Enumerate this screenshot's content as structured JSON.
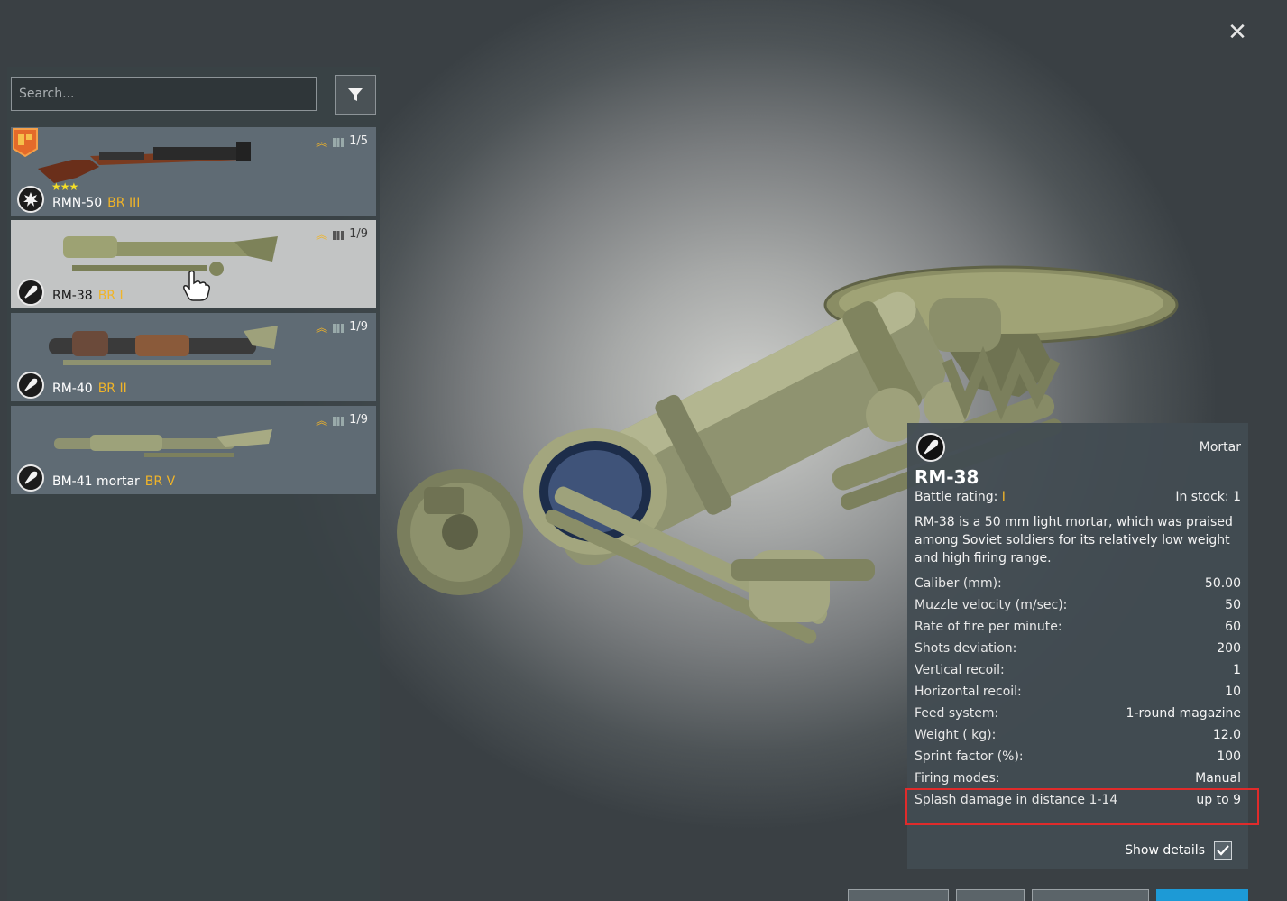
{
  "close_icon": "close-icon",
  "search": {
    "placeholder": "Search..."
  },
  "filter_icon": "filter-icon",
  "items": [
    {
      "name": "RMN-50",
      "br": "BR III",
      "stock": "1/5",
      "type_icon": "explosion-icon",
      "stars": "★★★",
      "battlepass_badge": "BP",
      "selected": false
    },
    {
      "name": "RM-38",
      "br": "BR I",
      "stock": "1/9",
      "type_icon": "mortar-shell-icon",
      "selected": true
    },
    {
      "name": "RM-40",
      "br": "BR II",
      "stock": "1/9",
      "type_icon": "mortar-shell-icon",
      "selected": false
    },
    {
      "name": "BM-41 mortar",
      "br": "BR V",
      "stock": "1/9",
      "type_icon": "mortar-shell-icon",
      "selected": false
    }
  ],
  "details": {
    "type_icon": "mortar-shell-icon",
    "class_label": "Mortar",
    "title": "RM-38",
    "br_label": "Battle rating:",
    "br_value": "I",
    "stock_label": "In stock: 1",
    "description": "RM-38 is a 50 mm light mortar, which was praised among Soviet soldiers for its relatively low weight and high firing range.",
    "stats": [
      {
        "label": "Caliber (mm):",
        "value": "50.00"
      },
      {
        "label": "Muzzle velocity (m/sec):",
        "value": "50"
      },
      {
        "label": "Rate of fire per minute:",
        "value": "60"
      },
      {
        "label": "Shots deviation:",
        "value": "200"
      },
      {
        "label": "Vertical recoil:",
        "value": "1"
      },
      {
        "label": "Horizontal recoil:",
        "value": "10"
      },
      {
        "label": "Feed system:",
        "value": "1-round magazine"
      },
      {
        "label": "Weight ( kg):",
        "value": "12.0"
      },
      {
        "label": "Sprint factor (%):",
        "value": "100"
      },
      {
        "label": "Firing modes:",
        "value": "Manual"
      },
      {
        "label": "Splash damage in distance 1-14",
        "value": "up to 9"
      }
    ],
    "show_details_label": "Show details",
    "show_details_checked": true
  },
  "colors": {
    "br_accent": "#f0b429",
    "highlight": "#e02b2b",
    "primary_button": "#1d9ad6"
  }
}
